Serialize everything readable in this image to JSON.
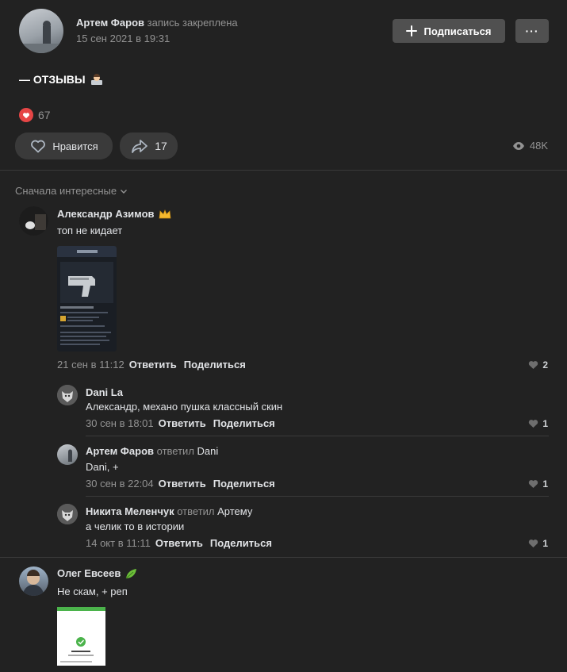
{
  "post": {
    "author": "Артем Фаров",
    "pinned_label": "запись закреплена",
    "date": "15 сен 2021 в 19:31",
    "subscribe_label": "Подписаться",
    "more_label": "···",
    "text": "— ОТЗЫВЫ",
    "reaction_count": "67",
    "like_label": "Нравится",
    "share_count": "17",
    "views": "48K"
  },
  "sort": {
    "label": "Сначала интересные"
  },
  "comments": [
    {
      "author": "Александр Азимов",
      "text": "топ не кидает",
      "date": "21 сен в 11:12",
      "reply_label": "Ответить",
      "share_label": "Поделиться",
      "likes": "2",
      "replies": [
        {
          "author": "Dani La",
          "replied_label": "",
          "replied_to": "",
          "text": "Александр, механо пушка классный скин",
          "date": "30 сен в 18:01",
          "reply_label": "Ответить",
          "share_label": "Поделиться",
          "likes": "1"
        },
        {
          "author": "Артем Фаров",
          "replied_label": "ответил",
          "replied_to": "Dani",
          "text": "Dani, +",
          "date": "30 сен в 22:04",
          "reply_label": "Ответить",
          "share_label": "Поделиться",
          "likes": "1"
        },
        {
          "author": "Никита Меленчук",
          "replied_label": "ответил",
          "replied_to": "Артему",
          "text": "а челик то в истории",
          "date": "14 окт в 11:11",
          "reply_label": "Ответить",
          "share_label": "Поделиться",
          "likes": "1"
        }
      ]
    },
    {
      "author": "Олег Евсеев",
      "text": "Не скам, + реп"
    }
  ],
  "colors": {
    "accent_red": "#e64646",
    "bg": "#222222",
    "button": "#505050",
    "pill": "#3a3a3a",
    "green": "#4bb34b"
  }
}
